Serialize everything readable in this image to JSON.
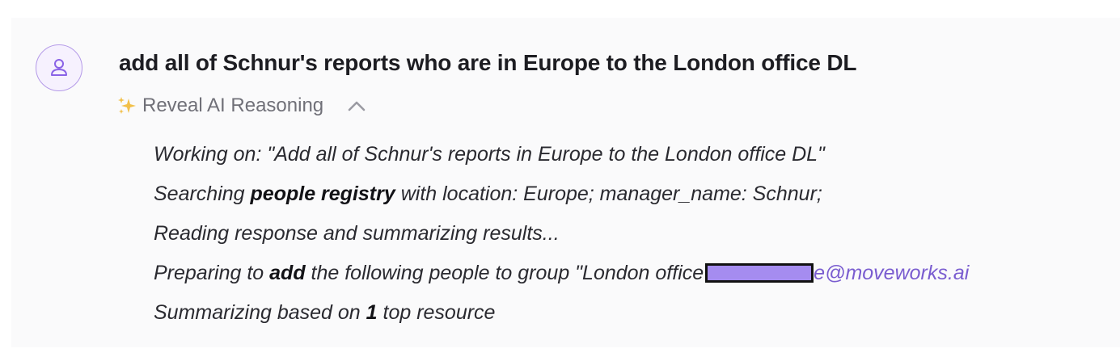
{
  "message": {
    "avatar_icon": "user-icon",
    "title": "add all of Schnur's reports who are in Europe to the London office DL"
  },
  "reasoning_toggle": {
    "sparkle_icon": "sparkle-icon",
    "label": "Reveal AI Reasoning",
    "chevron_icon": "chevron-up-icon"
  },
  "steps": [
    {
      "prefix": "Working on: \"Add all of Schnur's reports in Europe to the London office DL\""
    },
    {
      "prefix": "Searching ",
      "bold": "people registry",
      "suffix": " with  location: Europe;  manager_name: Schnur;"
    },
    {
      "prefix": "Reading response and summarizing results..."
    },
    {
      "prefix": "Preparing to ",
      "bold": "add",
      "suffix": " the following people to group \"London office",
      "email_suffix": "e@moveworks.ai"
    },
    {
      "prefix": "Summarizing based on ",
      "bold": "1",
      "suffix": " top resource"
    }
  ],
  "colors": {
    "accent": "#7a5dd0",
    "redaction": "#a58cf0",
    "background": "#fafafb"
  }
}
